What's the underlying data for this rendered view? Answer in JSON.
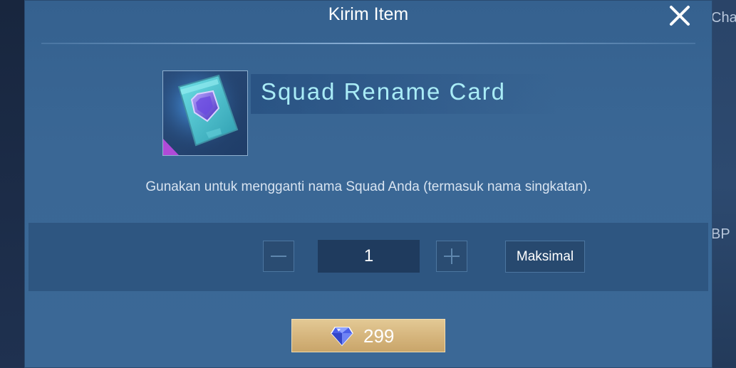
{
  "dialog": {
    "title": "Kirim Item",
    "close_icon": "close-icon"
  },
  "background": {
    "right_labels": [
      "Cha",
      "BP"
    ]
  },
  "item": {
    "name": "Squad Rename Card",
    "icon": "squad-rename-card-icon",
    "description": "Gunakan untuk mengganti nama Squad Anda (termasuk nama singkatan)."
  },
  "quantity": {
    "value": "1",
    "minus_icon": "minus-icon",
    "plus_icon": "plus-icon",
    "max_label": "Maksimal"
  },
  "purchase": {
    "price": "299",
    "currency_icon": "diamond-icon"
  },
  "colors": {
    "dialog_bg": "#3a6795",
    "item_name": "#a9ecf6",
    "buy_button": "#d6b67e"
  }
}
